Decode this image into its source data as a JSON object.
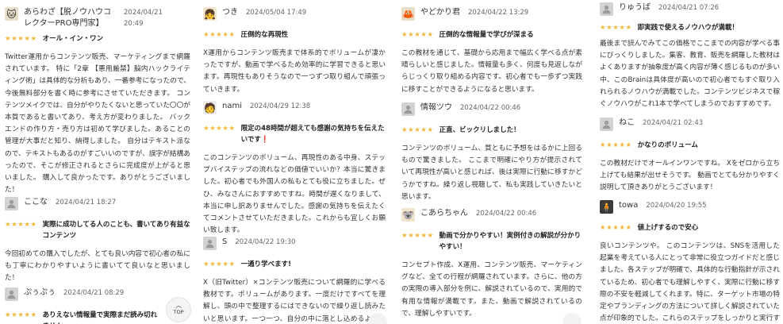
{
  "columns": [
    [
      {
        "name": "あらわざ【脱ノウハウコレクターPRO専門家】",
        "date": "2024/04/21 20:49",
        "stars": "★★★★★",
        "title": "オール・イン・ワン",
        "body": "Twitter運用からコンテンツ販売、マーケティングまで網羅されています。 特に「2章 【悪用厳禁】脳内ハックライティング術」は具体的な分析もあり、一番参考になったので、今後無料部分を書く時に参考にさせていただきます。 コンテンツメイクでは、自分がやりたくないと思っていた〇〇が本質であると書いてあり、考え方が変わりました。 バックエンドの作り方・売り方は初めて学びました。あることの管理が大事だと知り、納得しました。 自分はテキスト派なので、テキストもあるのがすごいいのですが、誤字が結構あったので、そこが修正されるとさらに完成度が上がると思いました。 購入して良かったです。ありがとうございました！",
        "avatar": "photo"
      },
      {
        "name": "ここな",
        "date": "2024/04/21 18:27",
        "stars": "★★★★★",
        "title": "実際に成功してる人のことも、書いてあり有益なコンテンツ",
        "body": "今回初めての購入でしたが、とても良い内容で初心者の私にも丁寧にわかりやすいように書いてて良いなと思いました！",
        "avatar": "default"
      },
      {
        "name": "ぷぅぷぅ",
        "date": "2024/04/21 08:29",
        "stars": "★★★★★",
        "title": "ありえない情報量で実際まだ読み切れません",
        "body": "",
        "avatar": "default"
      }
    ],
    [
      {
        "name": "つき",
        "date": "2024/05/04 17:49",
        "stars": "★★★★★",
        "title": "圧倒的な再現性",
        "body": "X運用からコンテンツ販売まで体系的でボリュームが凄かったですが、動画で学べるため効率的に学習できると思います。再現性もありそうなので一つずつ取り組んで頑張っていきます。",
        "avatar": "anime"
      },
      {
        "name": "nami",
        "date": "2024/04/29 12:38",
        "stars": "★★★★★",
        "title": "限定の48時間が超えても感謝の気持ちを伝えたいです",
        "title_mark": "❗",
        "body": "このコンテンツのボリューム、再現性のある中身、ステップバイステップの流れなどの価値でいいか？本当に驚きました。初心者でも外国人の私もとても役に立ちました。ぜひ、みなさんにおすすめですね。時間が遅くなりまして、本当に申し訳ありませんでした。感謝の気持ちを伝えたくてコメントさせていただきました。これからも宜しくお願い致します。",
        "avatar": "nami"
      },
      {
        "name": "S",
        "date": "2024/04/22 19:30",
        "stars": "★★★★★",
        "title": "一通り学べます!",
        "body": "X（旧Twitter）×コンテンツ販売について網羅的に学べる教材です。ボリュームがあります。一度だけですべてを理解し、頭の中で整理するにはできないので繰り返し読みたいと思います。一つ一つ、自分の中に落とし込めるように頑張ります。ありがとうございました。",
        "avatar": "default"
      }
    ],
    [
      {
        "name": "やどかり君",
        "date": "2024/04/22 13:29",
        "stars": "★★★★★",
        "title": "圧倒的な情報量で学びが深まる",
        "body": "この教材を通じて、基礎から応用まで幅広く学べる点が素晴らしいと感じました。情報量も多く、何度も見返しながらじっくり取り組める内容です。初心者でも一歩ずつ実践に移すことができるようになると思います。",
        "avatar": "photo"
      },
      {
        "name": "情報ツウ",
        "date": "2024/04/22 00:46",
        "stars": "★★★★★",
        "title": "正直、ビックリしました！",
        "body": "コンテンツのボリューム、質ともに予想をはるかに上回るもので驚きました。 ここまで明確にやり方が提示されていて再現性が高いと感じれば、後は実際に行動に移すかどうかですね。繰り返し視聴して、私も実践していきたいと思います。",
        "avatar": "default"
      },
      {
        "name": "こあらちゃん",
        "date": "2024/04/22 00:46",
        "stars": "★★★★★",
        "title": "動画で分かりやすい！実例付きの解説が分かりやすい！",
        "body": "コンセプト作成、X運用、コンテンツ販売、マーケティングなど、全ての行程が網羅されています。さらに、他の方の実際の導入部分を例に、解説されているので、実用的で有用な情報が満載です。また、動画で解説されているので、理解しやすいです。",
        "avatar": "anime"
      }
    ],
    [
      {
        "name": "りゅうば",
        "date": "2024/04/21 07:26",
        "stars": "★★★★★",
        "title": "即実践で使えるノウハウが満載！",
        "body": "最後まで読んでみてこの価格でここまでの内容が学べる事にびっくりしました。集客、教育、販売を網羅した教材はよくありますが抽象度が高く内容が薄く感じるものが多い中、このBrainは具体度が高いので初心者でもすぐ取り入れられるノウハウが満載でした。コンテンツビジネスで稼ぐノウハウがこれ1本で学べてしまうのでおすすめです。",
        "avatar": "default"
      },
      {
        "name": "ねこ",
        "date": "2024/04/21 02:43",
        "stars": "★★★★★",
        "title": "かなりのボリューム",
        "body": "この教材だけでオールインワンですね。 Xをゼロから立ち上げても結果が出せそうです。 動画でとても分かりやすく説明して頂きありがとうございます！",
        "avatar": "default"
      },
      {
        "name": "towa",
        "date": "2024/04/20 19:55",
        "stars": "★★★★★",
        "title": "値上げするので安心",
        "body": "良いコンテンツや。 このコンテンツは、SNSを活用した起業を考えている人にとって非常に役立つガイドだと感じました。各ステップが明確で、具体的な行動指針が示されているため、初心者でも理解しやすく、実際に行動に移す際の不安を軽減してくれます。特に、ターゲット市場の特定やブランディングの方法について詳しく解説されていた点が印象的でした。これらのステップをしっかりと実行することで、効果的にフォロワーを増やせそうでした。",
        "avatar": "dark"
      }
    ]
  ],
  "top_button": {
    "label": "TOP",
    "icon": "chevron-up-icon"
  },
  "colors": {
    "star": "#f1b83b",
    "text": "#333333",
    "accent_mark": "#e03030"
  }
}
